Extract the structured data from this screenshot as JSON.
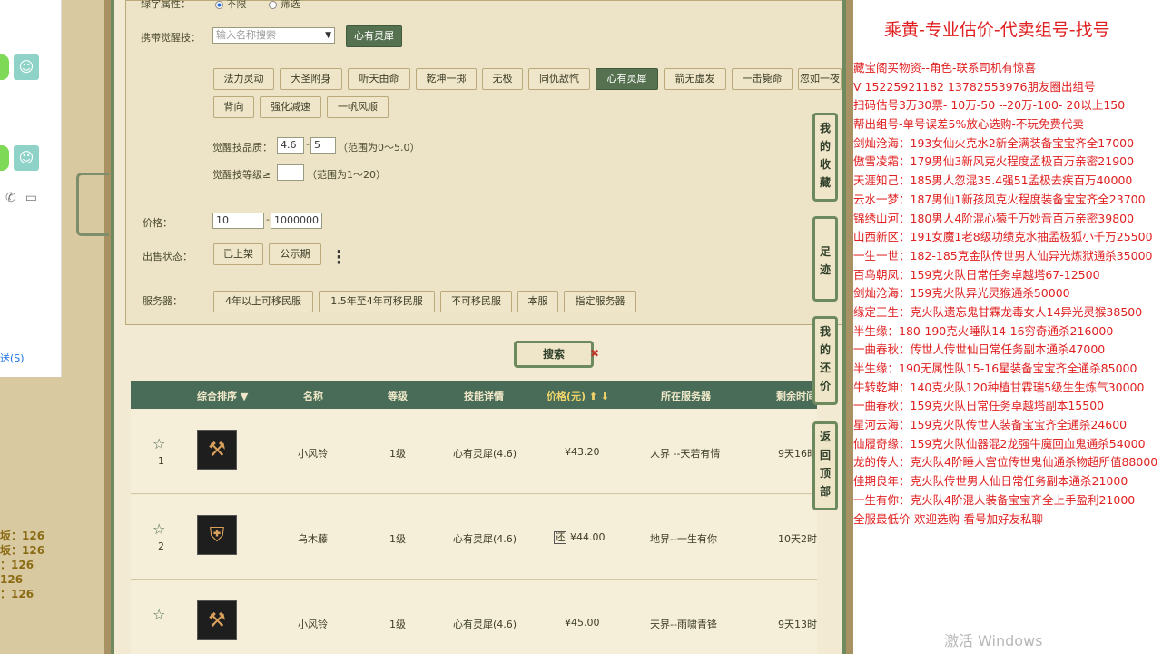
{
  "chat": {
    "send_label": "送(S)",
    "stats": [
      "坂：126",
      "坂：126",
      "：126",
      "126",
      "：126"
    ]
  },
  "filter": {
    "top_label": "绿字属性：",
    "radio1": "不限",
    "radio2": "筛选",
    "awaken_label": "携带觉醒技：",
    "awaken_placeholder": "输入名称搜索",
    "awaken_selected": "心有灵犀",
    "skills_row1": [
      "法力灵动",
      "大圣附身",
      "听天由命",
      "乾坤一掷",
      "无极",
      "同仇敌忾",
      "心有灵犀",
      "箭无虚发",
      "一击毙命",
      "忽如一夜"
    ],
    "skills_row2": [
      "背向",
      "强化减速",
      "一帆风顺"
    ],
    "active_skill": "心有灵犀",
    "quality_label": "觉醒技品质：",
    "quality_min": "4.6",
    "quality_max": "5",
    "quality_hint": "（范围为0～5.0）",
    "level_label": "觉醒技等级≥",
    "level_value": "",
    "level_hint": "（范围为1～20）",
    "price_label": "价格：",
    "price_min": "10",
    "price_max": "1000000",
    "status_label": "出售状态：",
    "status_options": [
      "已上架",
      "公示期"
    ],
    "server_label": "服务器：",
    "server_options": [
      "4年以上可移民服",
      "1.5年至4年可移民服",
      "不可移民服",
      "本服",
      "指定服务器"
    ],
    "search_label": "搜索"
  },
  "table": {
    "headers": {
      "sort": "综合排序 ▼",
      "name": "名称",
      "level": "等级",
      "skill": "技能详情",
      "price": "价格(元) ⬆ ⬇",
      "server": "所在服务器",
      "time": "剩余时间"
    },
    "rows": [
      {
        "rank": "1",
        "name": "小风铃",
        "level": "1级",
        "skill": "心有灵犀(4.6)",
        "price": "¥43.20",
        "server": "人界 --天若有情",
        "time": "9天16时",
        "bargain": ""
      },
      {
        "rank": "2",
        "name": "乌木藤",
        "level": "1级",
        "skill": "心有灵犀(4.6)",
        "price": "¥44.00",
        "server": "地界--一生有你",
        "time": "10天2时",
        "bargain": "还"
      },
      {
        "rank": "",
        "name": "小风铃",
        "level": "1级",
        "skill": "心有灵犀(4.6)",
        "price": "¥45.00",
        "server": "天界--雨啸青锋",
        "time": "9天13时",
        "bargain": ""
      }
    ]
  },
  "side_tabs": [
    "我的收藏",
    "足迹",
    "我的还价",
    "返回顶部"
  ],
  "right_panel": {
    "title": "乘黄-专业估价-代卖组号-找号",
    "lines": [
      "藏宝阁买物资--角色-联系司机有惊喜",
      "V 15225921182  13782553976朋友圈出组号",
      "扫码估号3万30票- 10万-50 --20万-100- 20以上150",
      "帮出组号-单号误差5%放心选购-不玩免费代卖",
      "剑灿沧海：193女仙火克水2新全满装备宝宝齐全17000",
      "傲雪凌霜：179男仙3新风克火程度孟极百万亲密21900",
      "天涯知己：185男人忽混35.4强51孟极去疾百万40000",
      "云水一梦：187男仙1新孩风克火程度装备宝宝齐全23700",
      "锦绣山河：180男人4阶混心猿千万妙音百万亲密39800",
      "山西新区：191女魔1老8级功绩克水抽孟极狐小千万25500",
      "一生一世：182-185克金队传世男人仙异光炼狱通杀35000",
      "百鸟朝凤：159克火队日常任务卓越塔67-12500",
      "剑灿沧海：159克火队异光灵猴通杀50000",
      "缘定三生：克火队遗忘鬼甘霖龙毒女人14异光灵猴38500",
      "半生缘：180-190克火睡队14-16穷奇通杀216000",
      "一曲春秋：传世人传世仙日常任务副本通杀47000",
      "半生缘：190无属性队15-16星装备宝宝齐全通杀85000",
      "牛转乾坤：140克火队120种植甘霖瑞5级生生炼气30000",
      "一曲春秋：159克火队日常任务卓越塔副本15500",
      "星河云海：159克火队传世人装备宝宝齐全通杀24600",
      "仙履奇缘：159克火队仙器混2龙强牛魔回血鬼通杀54000",
      "龙的传人：克火队4阶睡人宫位传世鬼仙通杀物超所值88000",
      "佳期良年：克火队传世男人仙日常任务副本通杀21000",
      "一生有你：克火队4阶混人装备宝宝齐全上手盈利21000",
      "全服最低价-欢迎选购-看号加好友私聊"
    ]
  },
  "watermark": "激活 Windows"
}
